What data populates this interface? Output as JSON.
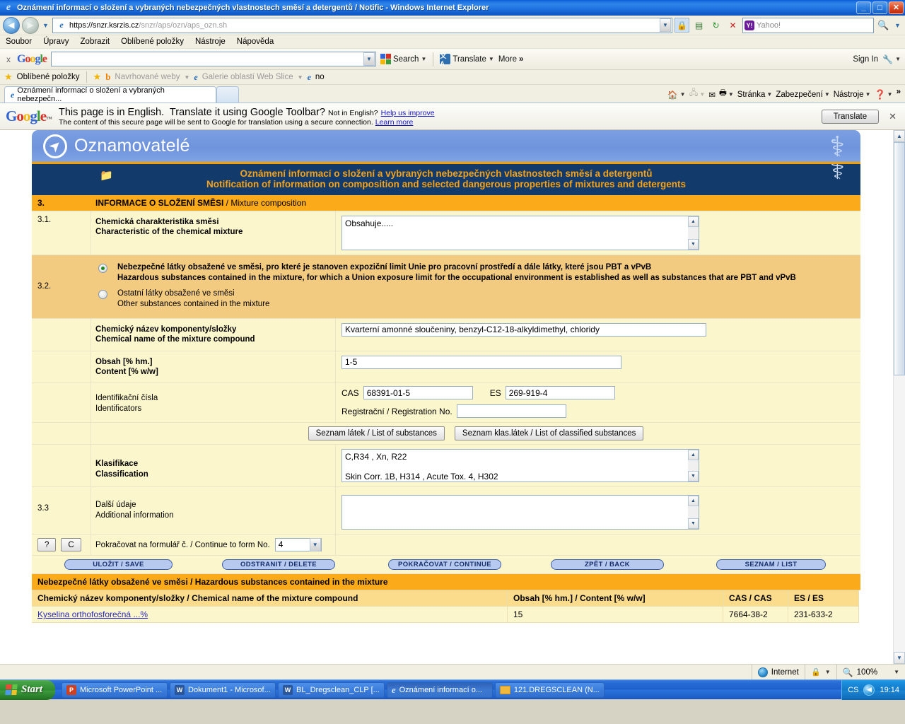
{
  "window": {
    "title": "Oznámení informací o složení a vybraných nebezpečných vlastnostech směsí a detergentů / Notific  - Windows Internet Explorer",
    "minimize": "_",
    "maximize": "□",
    "close": "✕"
  },
  "address": {
    "url_secure": "https://snzr.ksrzis.cz",
    "url_path": "/snzr/aps/ozn/aps_ozn.sh",
    "search_placeholder": "Yahoo!",
    "back": "◀",
    "forward": "▶",
    "stop": "✕",
    "refresh": "↻"
  },
  "menu": {
    "items": [
      "Soubor",
      "Úpravy",
      "Zobrazit",
      "Oblíbené položky",
      "Nástroje",
      "Nápověda"
    ]
  },
  "google_toolbar": {
    "close": "x",
    "logo": "Google",
    "search_value": "",
    "search_label": "Search",
    "translate_label": "Translate",
    "more_label": "More",
    "more_glyph": "»",
    "sign_in": "Sign In"
  },
  "favorites_bar": {
    "label": "Oblíbené položky",
    "items": [
      "Navrhované weby",
      "Galerie oblastí Web Slice",
      "no"
    ]
  },
  "tabs": {
    "active_title": "Oznámení informací o složení a vybraných nebezpečn...",
    "new_tab": ""
  },
  "tab_tools": {
    "items": [
      "Stránka",
      "Zabezpečení",
      "Nástroje"
    ],
    "overflow": "»"
  },
  "translate_bar": {
    "logo": "Google",
    "tm": "™",
    "line1_a": "This page is in English.",
    "line1_b": "Translate it using Google Toolbar?",
    "line1_c": "Not in English?",
    "line1_link": "Help us improve",
    "line2": "The content of this secure page will be sent to Google for translation using a secure connection.",
    "line2_link": "Learn more",
    "button": "Translate",
    "close": "✕"
  },
  "form": {
    "brand": "Oznamovatelé",
    "title_cz": "Oznámení informací o složení a vybraných nebezpečných vlastnostech směsí a detergentů",
    "title_en": "Notification of information on composition and selected dangerous properties of mixtures and detergents",
    "section": {
      "number": "3.",
      "label_cz": "INFORMACE O SLOŽENÍ SMĚSI",
      "sep": " / ",
      "label_en": "Mixture composition"
    },
    "row_31": {
      "number": "3.1.",
      "label_cz": "Chemická charakteristika směsi",
      "label_en": "Characteristic of the chemical mixture",
      "value": "Obsahuje....."
    },
    "row_32": {
      "number": "3.2.",
      "option1_cz": "Nebezpečné látky obsažené ve směsi, pro které je stanoven expoziční limit Unie pro pracovní prostředí a dále látky, které jsou PBT a vPvB",
      "option1_en": "Hazardous substances contained in the mixture, for which a Union exposure limit for the occupational environment is established as well as substances that are PBT and vPvB",
      "option1_selected": true,
      "option2_cz": "Ostatní látky obsažené ve směsi",
      "option2_en": "Other substances contained in the mixture",
      "option2_selected": false
    },
    "row_name": {
      "label_cz": "Chemický název komponenty/složky",
      "label_en": "Chemical name of the mixture compound",
      "value": "Kvarterní amonné sloučeniny, benzyl-C12-18-alkyldimethyl, chloridy"
    },
    "row_content": {
      "label_cz": "Obsah [% hm.]",
      "label_en": "Content [% w/w]",
      "value": "1-5"
    },
    "row_ids": {
      "label_cz": "Identifikační čísla",
      "label_en": "Identificators",
      "cas_label": "CAS",
      "cas_value": "68391-01-5",
      "es_label": "ES",
      "es_value": "269-919-4",
      "reg_label": "Registrační / Registration No.",
      "reg_value": ""
    },
    "list_buttons": {
      "substances": "Seznam látek / List of substances",
      "classified": "Seznam klas.látek / List of classified substances"
    },
    "row_class": {
      "label_cz": "Klasifikace",
      "label_en": "Classification",
      "line1": "C,R34 , Xn, R22",
      "line2": "Skin Corr. 1B, H314   , Acute Tox. 4, H302"
    },
    "row_33": {
      "number": "3.3",
      "label_cz": "Další údaje",
      "label_en": "Additional information",
      "value": ""
    },
    "continue_row": {
      "help_button": "?",
      "c_button": "C",
      "label": "Pokračovat na formulář č. / Continue to form No.",
      "select_value": "4"
    },
    "action_buttons": [
      "ULOŽIT / SAVE",
      "ODSTRANIT / DELETE",
      "POKRAČOVAT / CONTINUE",
      "ZPĚT / BACK",
      "SEZNAM / LIST"
    ],
    "table": {
      "caption": "Nebezpečné látky obsažené ve směsi / Hazardous substances contained in the mixture",
      "headers": [
        "Chemický název komponenty/složky / Chemical name of the mixture compound",
        "Obsah [% hm.] / Content [% w/w]",
        "CAS / CAS",
        "ES / ES"
      ],
      "rows": [
        [
          "Kyselina orthofosforečná ...%",
          "15",
          "7664-38-2",
          "231-633-2"
        ]
      ]
    }
  },
  "statusbar": {
    "zone": "Internet",
    "zoom": "100%"
  },
  "taskbar": {
    "start": "Start",
    "buttons": [
      {
        "label": "Microsoft PowerPoint ...",
        "icon": "powerpoint-icon",
        "active": false
      },
      {
        "label": "Dokument1 - Microsof...",
        "icon": "word-icon",
        "active": false
      },
      {
        "label": "BL_Dregsclean_CLP [...",
        "icon": "word-icon",
        "active": false
      },
      {
        "label": "Oznámení informací o...",
        "icon": "ie-icon",
        "active": true
      },
      {
        "label": "121.DREGSCLEAN (N...",
        "icon": "folder-icon",
        "active": false
      }
    ],
    "language": "CS",
    "clock": "19:14"
  }
}
